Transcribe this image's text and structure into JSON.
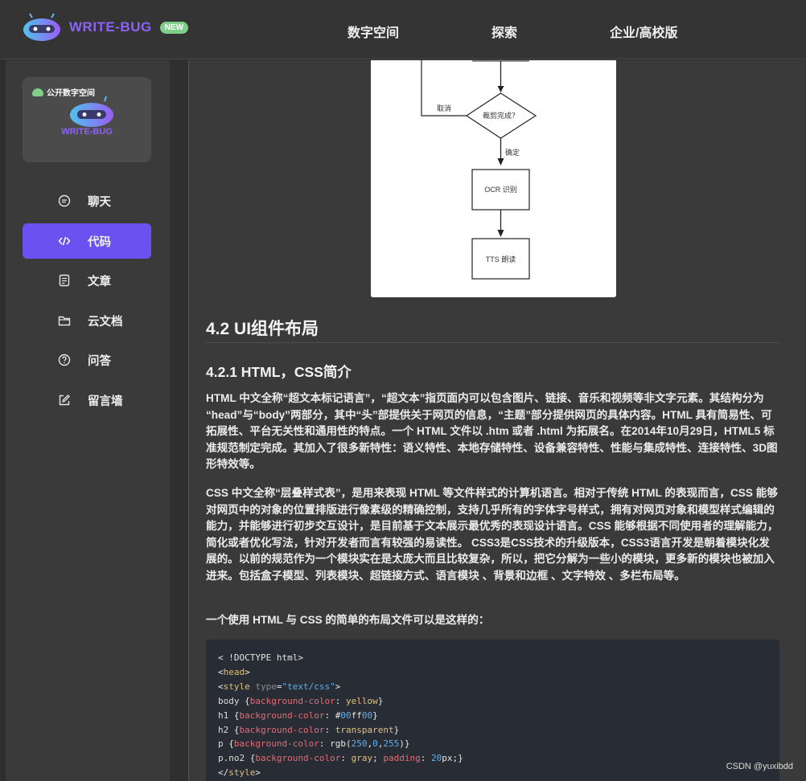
{
  "header": {
    "brand_name": "WRITE-BUG",
    "badge": "NEW",
    "nav": [
      "数字空间",
      "探索",
      "企业/高校版"
    ]
  },
  "sidebar": {
    "promo_tag": "公开数字空间",
    "promo_name": "WRITE-BUG",
    "items": [
      {
        "label": "聊天",
        "icon": "chat-icon"
      },
      {
        "label": "代码",
        "icon": "code-icon"
      },
      {
        "label": "文章",
        "icon": "article-icon"
      },
      {
        "label": "云文档",
        "icon": "folder-icon"
      },
      {
        "label": "问答",
        "icon": "question-icon"
      },
      {
        "label": "留言墙",
        "icon": "edit-icon"
      }
    ],
    "active_index": 1
  },
  "flowchart": {
    "cancel_label": "取消",
    "decision_label": "裁剪完成？",
    "confirm_label": "确定",
    "ocr_label": "OCR 识别",
    "tts_label": "TTS 朗读"
  },
  "article": {
    "h2": "4.2 UI组件布局",
    "h3": "4.2.1 HTML，CSS简介",
    "p1": "HTML 中文全称“超文本标记语言”，“超文本”指页面内可以包含图片、链接、音乐和视频等非文字元素。其结构分为 “head”与“body”两部分，其中“头”部提供关于网页的信息，“主题”部分提供网页的具体内容。HTML 具有简易性、可拓展性、平台无关性和通用性的特点。一个 HTML 文件以 .htm 或者 .html 为拓展名。在2014年10月29日，HTML5 标准规范制定完成。其加入了很多新特性：语义特性、本地存储特性、设备兼容特性、性能与集成特性、连接特性、3D图形特效等。",
    "p2": "CSS 中文全称“层叠样式表”，是用来表现 HTML 等文件样式的计算机语言。相对于传统 HTML 的表现而言，CSS 能够对网页中的对象的位置排版进行像素级的精确控制，支持几乎所有的字体字号样式，拥有对网页对象和模型样式编辑的能力，并能够进行初步交互设计，是目前基于文本展示最优秀的表现设计语言。CSS 能够根据不同使用者的理解能力，简化或者优化写法，针对开发者而言有较强的易读性。 CSS3是CSS技术的升级版本，CSS3语言开发是朝着模块化发展的。以前的规范作为一个模块实在是太庞大而且比较复杂，所以，把它分解为一些小的模块，更多新的模块也被加入进来。包括盒子模型、列表模块、超链接方式、语言模块 、背景和边框 、文字特效 、多栏布局等。",
    "p3": "一个使用 HTML 与 CSS 的简单的布局文件可以是这样的：",
    "code": [
      "< !DOCTYPE html>",
      "<head>",
      "<style type=\"text/css\">",
      "body {background-color: yellow}",
      "h1 {background-color: #00ff00}",
      "h2 {background-color: transparent}",
      "p {background-color: rgb(250,0,255)}",
      "p.no2 {background-color: gray; padding: 20px;}",
      "</style>"
    ]
  },
  "watermark": "CSDN @yuxibdd",
  "colors": {
    "accent": "#6b52f0",
    "brand": "#8b63f5",
    "badge": "#7fcf8a"
  }
}
